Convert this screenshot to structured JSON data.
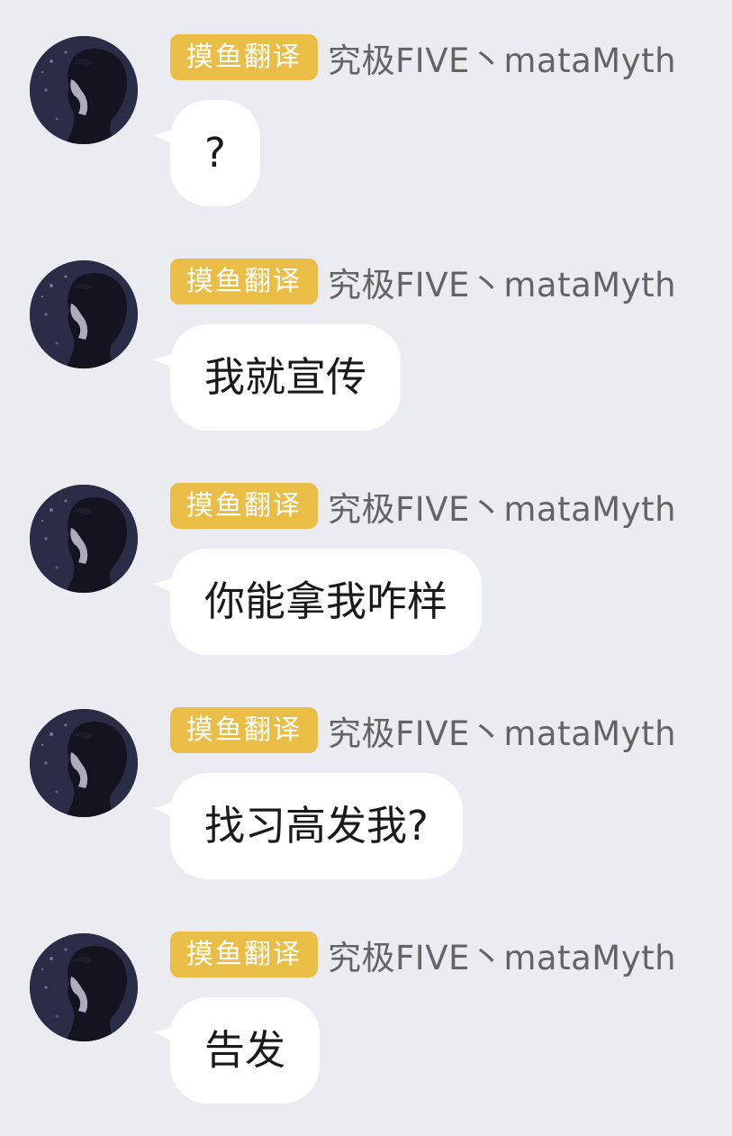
{
  "colors": {
    "background": "#ebecf1",
    "tag_background": "#e9bd46",
    "bubble_background": "#ffffff",
    "nickname_text": "#646466"
  },
  "messages": [
    {
      "tag": "摸鱼翻译",
      "nickname": "究极FIVE丶mataMyth",
      "text": "?",
      "avatar_icon": "anime-avatar-icon"
    },
    {
      "tag": "摸鱼翻译",
      "nickname": "究极FIVE丶mataMyth",
      "text": "我就宣传",
      "avatar_icon": "anime-avatar-icon"
    },
    {
      "tag": "摸鱼翻译",
      "nickname": "究极FIVE丶mataMyth",
      "text": "你能拿我咋样",
      "avatar_icon": "anime-avatar-icon"
    },
    {
      "tag": "摸鱼翻译",
      "nickname": "究极FIVE丶mataMyth",
      "text": "找习高发我?",
      "avatar_icon": "anime-avatar-icon"
    },
    {
      "tag": "摸鱼翻译",
      "nickname": "究极FIVE丶mataMyth",
      "text": "告发",
      "avatar_icon": "anime-avatar-icon"
    }
  ]
}
